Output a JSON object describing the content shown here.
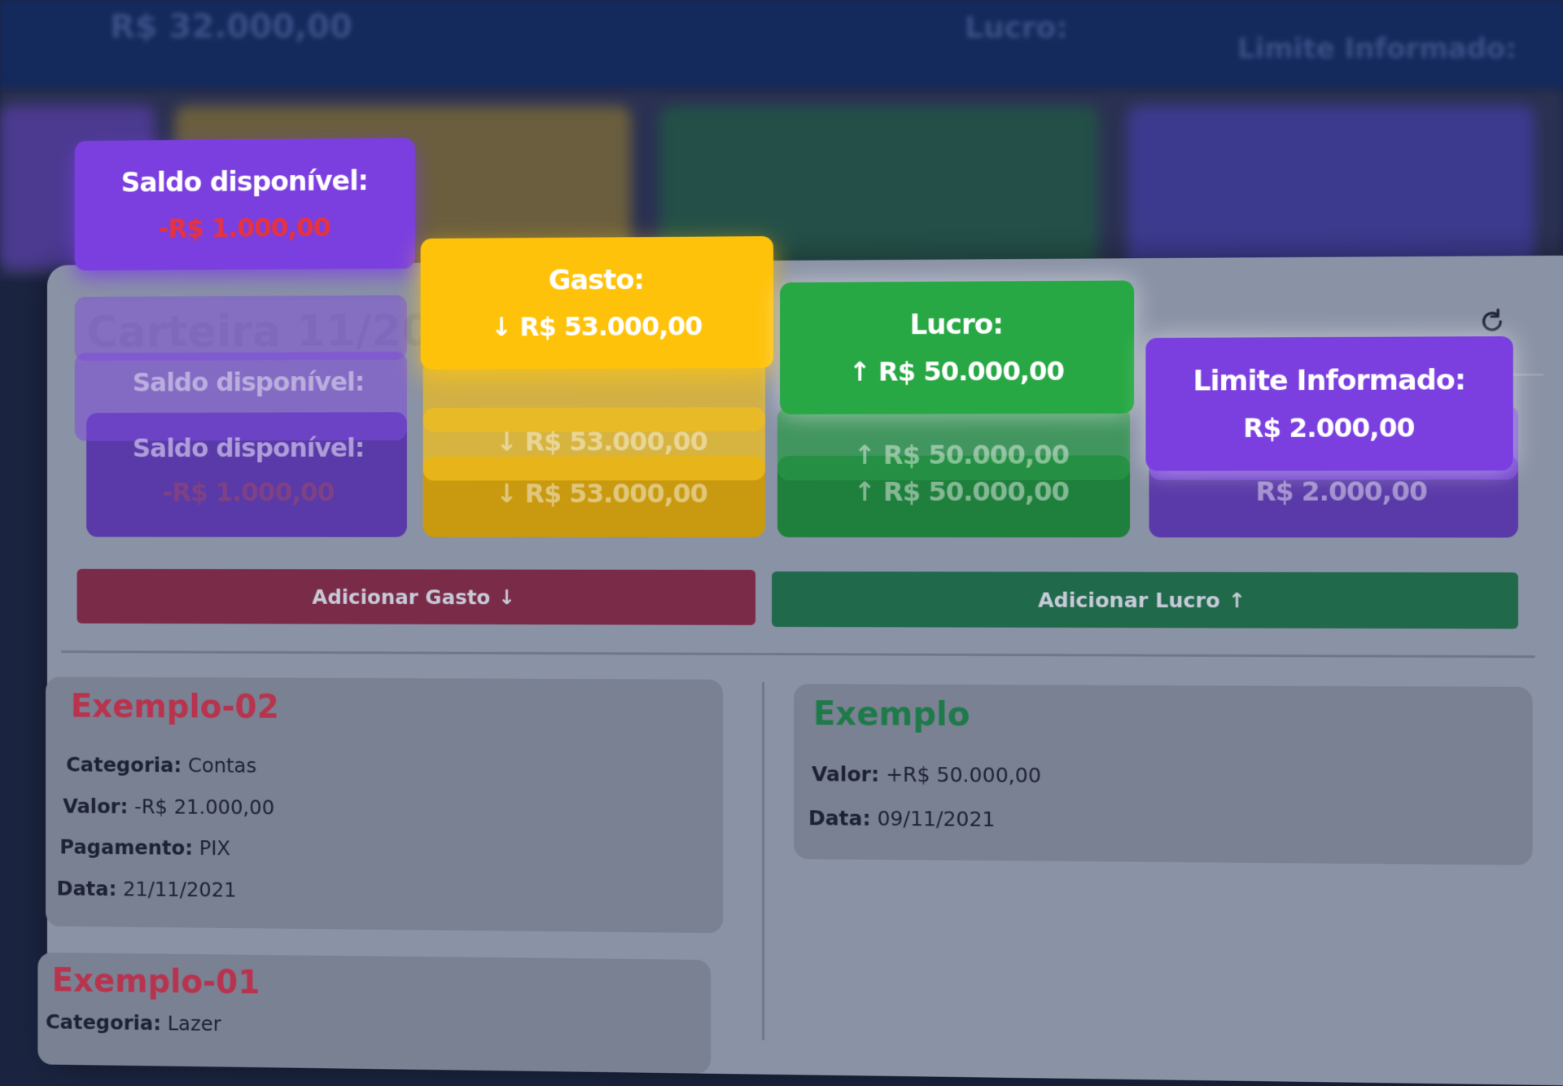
{
  "background": {
    "balance": "R$ 32.000,00",
    "profit_label": "Lucro:",
    "limit_label": "Limite Informado:"
  },
  "panel_title": "Carteira 11/2021",
  "cards": {
    "balance": {
      "label": "Saldo disponível:",
      "value": "-R$ 1.000,00",
      "color": "#7b3fe0",
      "value_color": "#e8323c"
    },
    "expense": {
      "label": "Gasto:",
      "value": "R$ 53.000,00",
      "arrow": "↓",
      "color": "#ffc20a"
    },
    "profit": {
      "label": "Lucro:",
      "value": "R$ 50.000,00",
      "arrow": "↑",
      "color": "#27a844"
    },
    "limit": {
      "label": "Limite Informado:",
      "value": "R$ 2.000,00",
      "color": "#7b3fe0"
    }
  },
  "buttons": {
    "add_expense": {
      "label": "Adicionar Gasto",
      "icon": "arrow-down-icon",
      "color": "#7a2b48"
    },
    "add_profit": {
      "label": "Adicionar Lucro",
      "icon": "arrow-up-icon",
      "color": "#20694a"
    }
  },
  "expenses": [
    {
      "title": "Exemplo-02",
      "category_label": "Categoria:",
      "category": "Contas",
      "value_label": "Valor:",
      "value": "-R$ 21.000,00",
      "payment_label": "Pagamento:",
      "payment": "PIX",
      "date_label": "Data:",
      "date": "21/11/2021"
    },
    {
      "title": "Exemplo-01",
      "category_label": "Categoria:",
      "category": "Lazer"
    }
  ],
  "profits": [
    {
      "title": "Exemplo",
      "value_label": "Valor:",
      "value": "+R$ 50.000,00",
      "date_label": "Data:",
      "date": "09/11/2021"
    }
  ],
  "colors": {
    "expense_title": "#b8334e",
    "profit_title": "#1f7a4a"
  }
}
